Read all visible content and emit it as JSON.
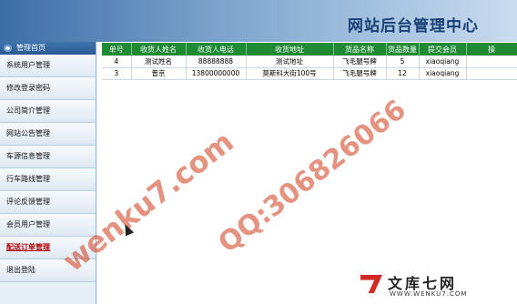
{
  "header": {
    "title": "网站后台管理中心"
  },
  "sidebar": {
    "top_label": "管理首页",
    "items": [
      {
        "label": "系统用户管理"
      },
      {
        "label": "修改登录密码"
      },
      {
        "label": "公司简介管理"
      },
      {
        "label": "网站公告管理"
      },
      {
        "label": "车源信息管理"
      },
      {
        "label": "行车路线管理"
      },
      {
        "label": "评论反馈管理"
      },
      {
        "label": "会员用户管理"
      },
      {
        "label": "配送订单管理"
      },
      {
        "label": "退出登陆"
      }
    ]
  },
  "orders": {
    "columns": [
      "单号",
      "收货人姓名",
      "收货人电话",
      "收货地址",
      "货品名称",
      "货品数量",
      "提交会员",
      "操"
    ],
    "rows": [
      [
        "4",
        "测试姓名",
        "88888888",
        "测试地址",
        "飞毛腿号牌",
        "5",
        "xiaoqiang",
        ""
      ],
      [
        "3",
        "普京",
        "13800000000",
        "莫斯科大街100号",
        "飞毛腿号牌",
        "12",
        "xiaoqiang",
        ""
      ]
    ]
  },
  "watermark": {
    "text1": "wenku7.com",
    "text2": "QQ:306826066"
  },
  "brand": {
    "name": "文库七网",
    "url": "WWW.WENKU7.COM"
  }
}
